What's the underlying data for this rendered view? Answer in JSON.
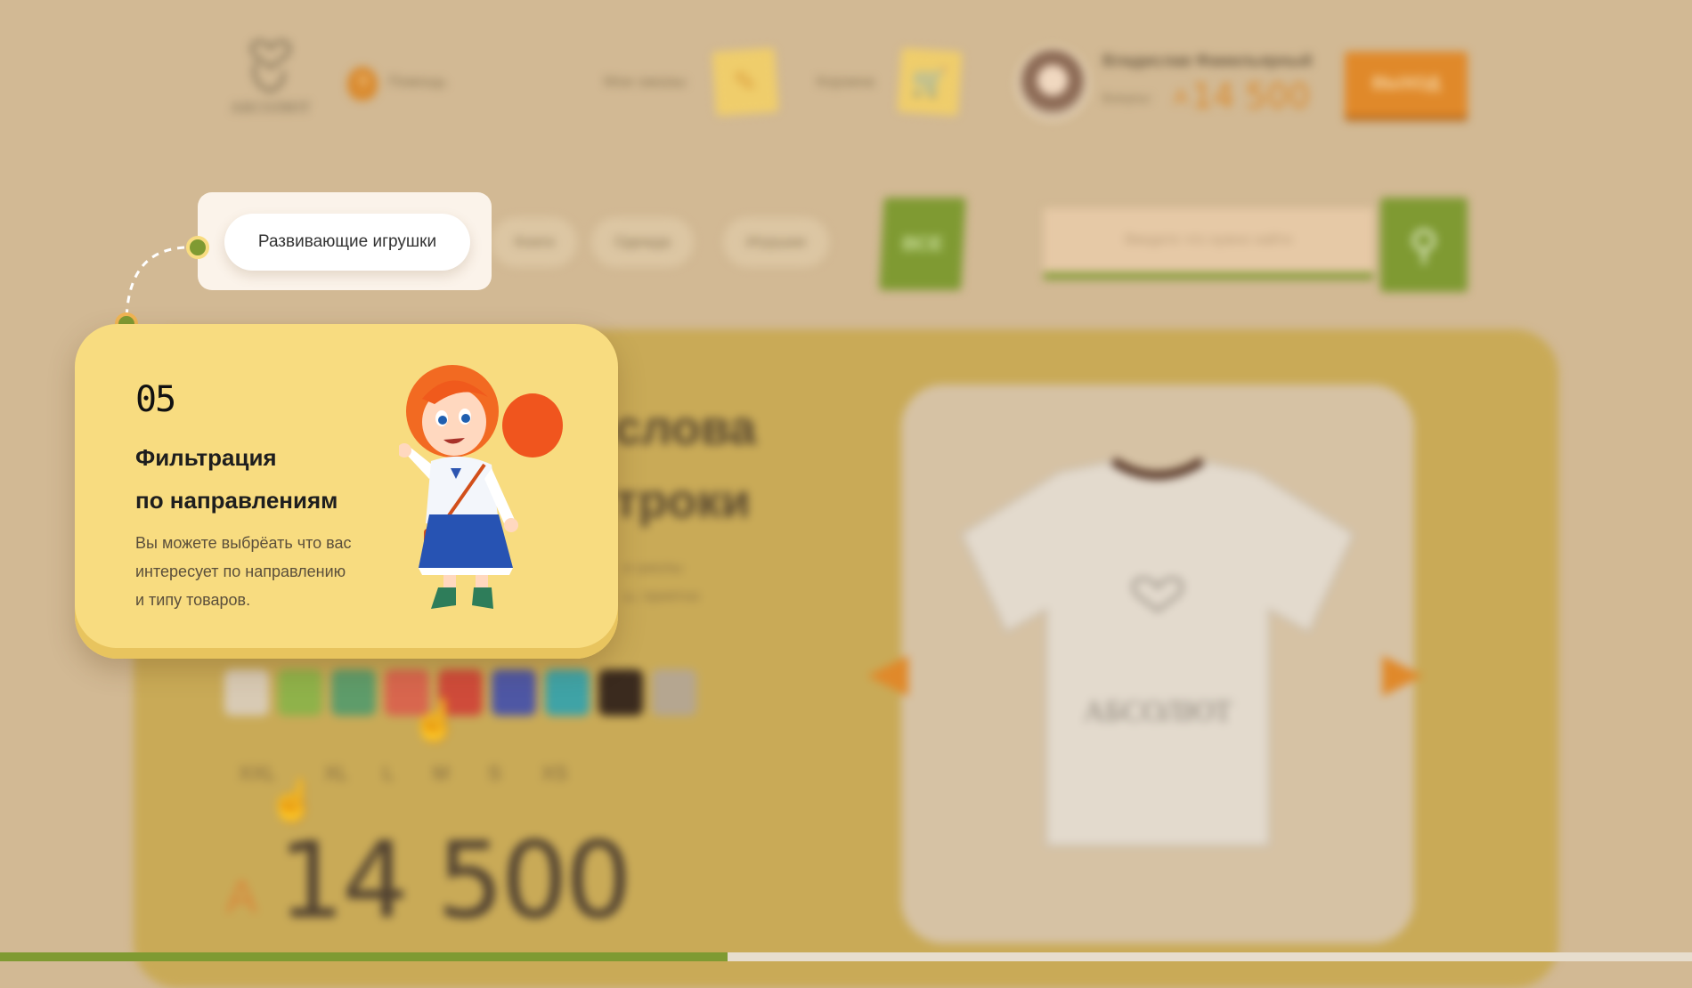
{
  "header": {
    "logo_text": "АБСОЛЮТ",
    "help_label": "Помощь",
    "orders_label": "Мои заказы",
    "cart_label": "Корзина",
    "user_name": "Владислав Фамильярный",
    "bonus_label": "Бонусы:",
    "bonus_currency": "A",
    "bonus_value": "14 500",
    "logout_label": "ВЫХОД"
  },
  "categories": {
    "active": "Развивающие игрушки",
    "items": [
      "Книги",
      "Одежда",
      "Игрушки"
    ],
    "all_label": "ВСЕ"
  },
  "search": {
    "placeholder": "Введите что нужно найти"
  },
  "product": {
    "title_line1": "слова",
    "title_line2": "троки",
    "desc_line1": "и школы",
    "desc_line2": "ы, приятно",
    "sizes": [
      "XXL",
      "XL",
      "L",
      "M",
      "S",
      "XS"
    ],
    "price_currency": "A",
    "price": "14 500",
    "tshirt_logo_text": "АБСОЛЮТ",
    "swatch_colors": [
      "#d8cab4",
      "#8fb24a",
      "#5e9c6a",
      "#d8664e",
      "#cf4b3a",
      "#4e57a4",
      "#3fa3a6",
      "#3a2a1e",
      "#b5a690"
    ]
  },
  "tip": {
    "step": "05",
    "title_line1": "Фильтрация",
    "title_line2": "по направлениям",
    "text_line1": "Вы можете выбрёать что вас",
    "text_line2": "интересует по направлению",
    "text_line3": "и типу товаров."
  },
  "progress": {
    "fraction": 0.43
  },
  "colors": {
    "accent_green": "#7f9a32",
    "accent_orange": "#e0892a",
    "card_yellow": "#f8dc80",
    "backdrop": "#d2b994"
  }
}
